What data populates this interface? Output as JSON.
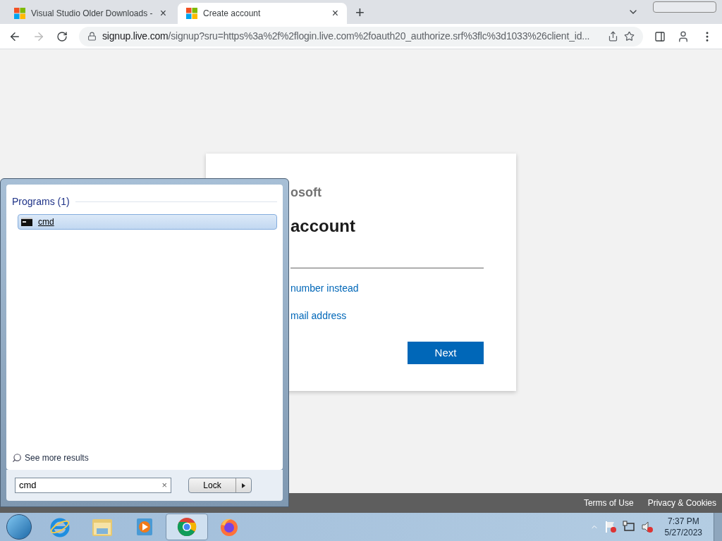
{
  "browser": {
    "tabs": [
      {
        "title": "Visual Studio Older Downloads -",
        "selected": false,
        "close": "×"
      },
      {
        "title": "Create account",
        "selected": true,
        "close": "×"
      }
    ],
    "new_tab": "+",
    "url_host": "signup.live.com",
    "url_path": "/signup?sru=https%3a%2f%2flogin.live.com%2foauth20_authorize.srf%3flc%3d1033%26client_id..."
  },
  "card": {
    "brand": "osoft",
    "heading": "account",
    "links": [
      "number instead",
      "mail address"
    ],
    "button": "Next"
  },
  "footer": {
    "links": [
      "Terms of Use",
      "Privacy & Cookies"
    ]
  },
  "start_menu": {
    "section": "Programs (1)",
    "results": [
      {
        "label": "cmd",
        "selected": true
      }
    ],
    "more": "See more results",
    "search_value": "cmd",
    "clear": "×",
    "power_button": "Lock"
  },
  "taskbar": {
    "apps": [
      {
        "kind": "ie",
        "active": false
      },
      {
        "kind": "explorer",
        "active": false
      },
      {
        "kind": "media",
        "active": false
      },
      {
        "kind": "chrome",
        "active": true
      },
      {
        "kind": "firefox",
        "active": false
      }
    ],
    "time": "7:37 PM",
    "date": "5/27/2023"
  }
}
